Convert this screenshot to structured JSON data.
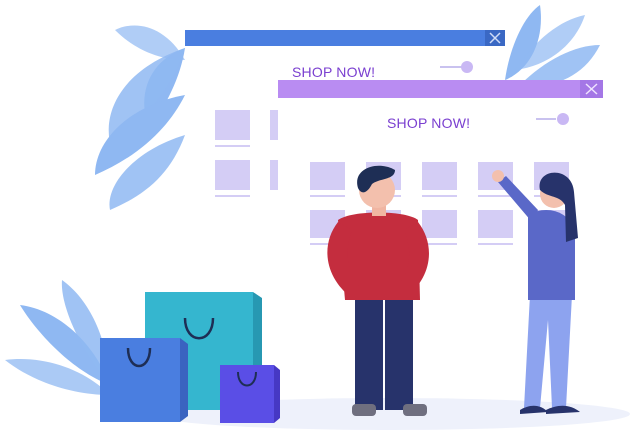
{
  "back_window": {
    "label": "SHOP NOW!",
    "titlebar_color": "#4a7ee0",
    "close_icon": "close-icon"
  },
  "front_window": {
    "label": "SHOP NOW!",
    "titlebar_color": "#b98cf2",
    "close_icon": "close-icon"
  },
  "colors": {
    "product_tile": "#d4cdf5",
    "leaf": "#8fb8f2",
    "bag_teal": "#35b6cf",
    "bag_blue": "#4a7ee0",
    "bag_indigo": "#5a4ee6",
    "man_shirt": "#c42d3e",
    "woman_top": "#5a68c8"
  },
  "illustration": {
    "people": [
      "man-figure",
      "woman-figure"
    ],
    "bags": [
      "teal-shopping-bag",
      "blue-shopping-bag",
      "indigo-shopping-bag"
    ]
  }
}
